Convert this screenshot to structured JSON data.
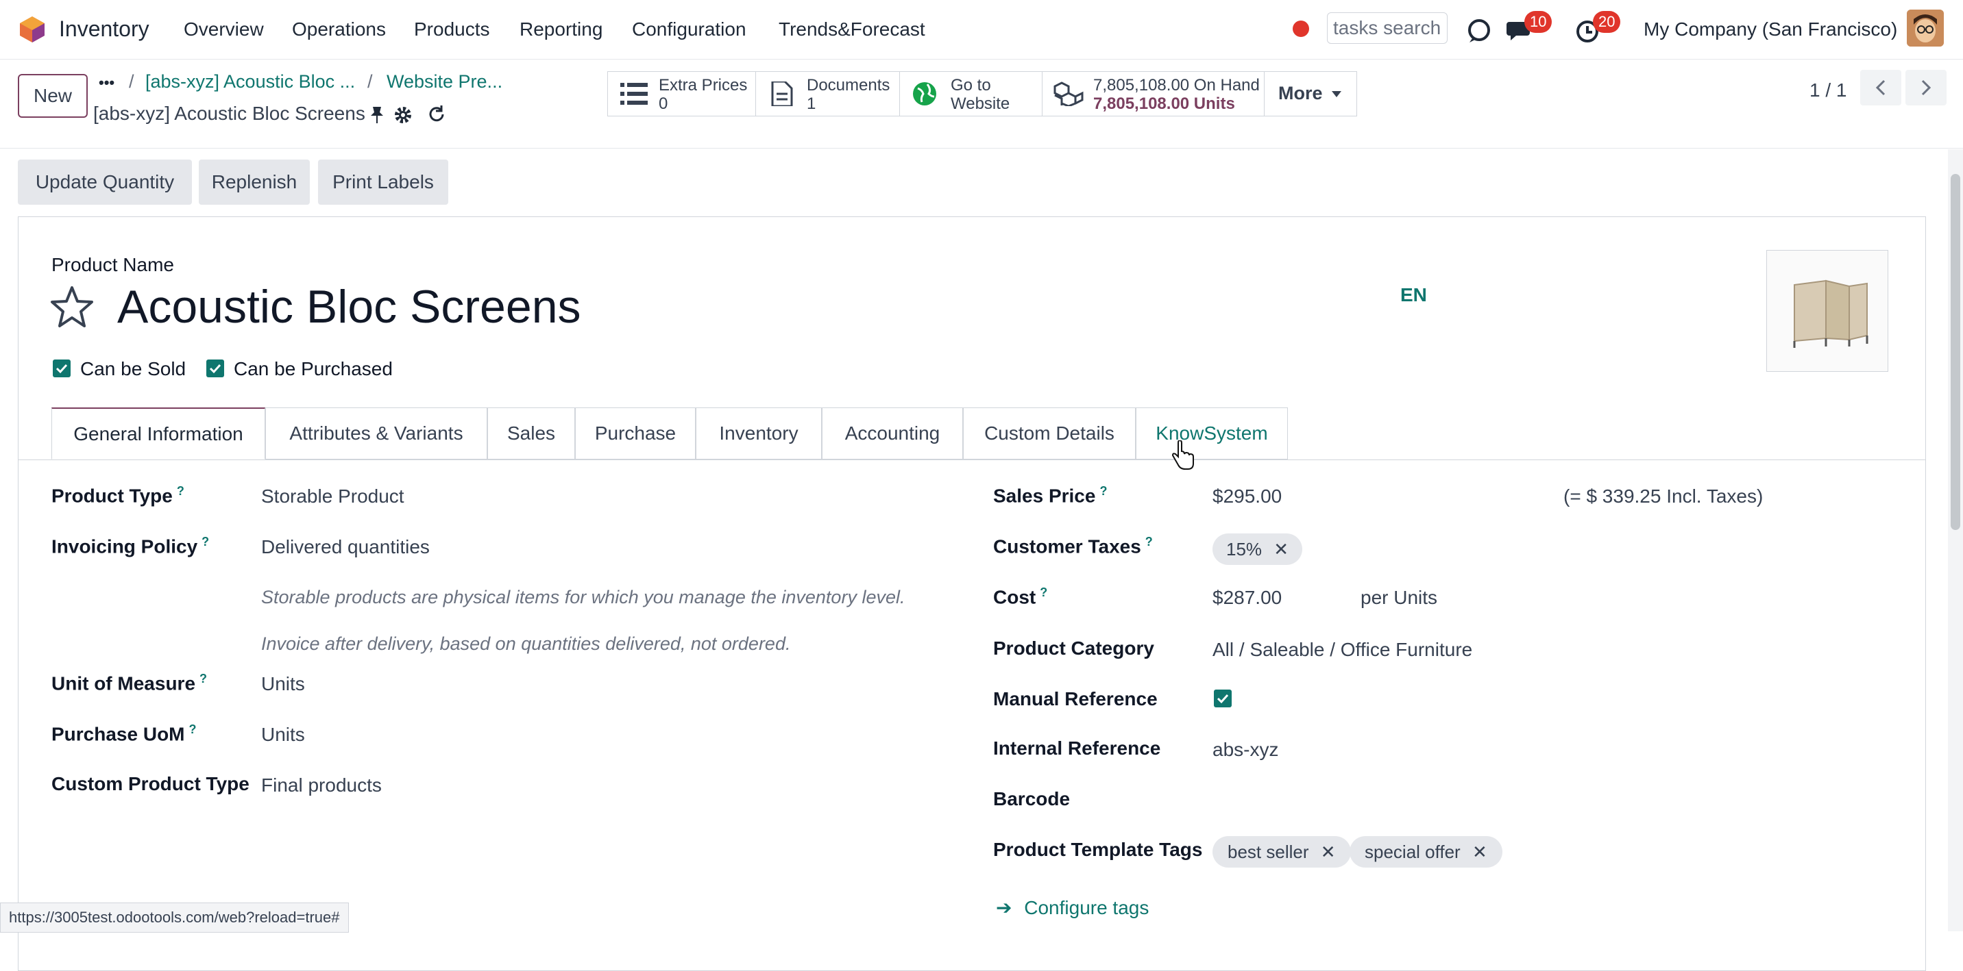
{
  "navbar": {
    "app_name": "Inventory",
    "menu": [
      "Overview",
      "Operations",
      "Products",
      "Reporting",
      "Configuration",
      "Trends&Forecast"
    ],
    "search_placeholder": "tasks search",
    "messages_count": "10",
    "activities_count": "20",
    "company": "My Company (San Francisco)",
    "record_color": "#e0352b",
    "brand_color": "#7b3f5f",
    "accent_color": "#0f766e"
  },
  "control": {
    "new_label": "New",
    "breadcrumb_more": "•••",
    "breadcrumbs": [
      "[abs-xyz] Acoustic Bloc ...",
      "Website Pre..."
    ],
    "record_name": "[abs-xyz] Acoustic Bloc Screens",
    "smart_buttons": {
      "extra_prices": {
        "label": "Extra Prices",
        "value": "0"
      },
      "documents": {
        "label": "Documents",
        "value": "1"
      },
      "website": {
        "label": "Go to",
        "value": "Website"
      },
      "on_hand": {
        "label": "7,805,108.00 On Hand",
        "value": "7,805,108.00 Units"
      }
    },
    "more_label": "More",
    "pager": "1 / 1"
  },
  "actions": [
    "Update Quantity",
    "Replenish",
    "Print Labels"
  ],
  "product": {
    "name_label": "Product Name",
    "name": "Acoustic Bloc Screens",
    "lang": "EN",
    "can_be_sold": "Can be Sold",
    "can_be_purchased": "Can be Purchased"
  },
  "tabs": [
    "General Information",
    "Attributes & Variants",
    "Sales",
    "Purchase",
    "Inventory",
    "Accounting",
    "Custom Details",
    "KnowSystem"
  ],
  "left_fields": {
    "product_type": {
      "label": "Product Type",
      "value": "Storable Product"
    },
    "invoicing_policy": {
      "label": "Invoicing Policy",
      "value": "Delivered quantities"
    },
    "hint_storable": "Storable products are physical items for which you manage the inventory level.",
    "hint_invoice": "Invoice after delivery, based on quantities delivered, not ordered.",
    "uom": {
      "label": "Unit of Measure",
      "value": "Units"
    },
    "purchase_uom": {
      "label": "Purchase UoM",
      "value": "Units"
    },
    "custom_type": {
      "label": "Custom Product Type",
      "value": "Final products"
    }
  },
  "right_fields": {
    "sales_price": {
      "label": "Sales Price",
      "value": "$295.00",
      "incl": "(= $ 339.25 Incl. Taxes)"
    },
    "customer_taxes": {
      "label": "Customer Taxes",
      "tag": "15%"
    },
    "cost": {
      "label": "Cost",
      "value": "$287.00",
      "unit": "per Units"
    },
    "category": {
      "label": "Product Category",
      "value": "All / Saleable / Office Furniture"
    },
    "manual_ref": {
      "label": "Manual Reference"
    },
    "internal_ref": {
      "label": "Internal Reference",
      "value": "abs-xyz"
    },
    "barcode": {
      "label": "Barcode"
    },
    "template_tags": {
      "label": "Product Template Tags",
      "tags": [
        "best seller",
        "special offer"
      ]
    },
    "configure_tags": "Configure tags"
  },
  "status_url": "https://3005test.odootools.com/web?reload=true#"
}
